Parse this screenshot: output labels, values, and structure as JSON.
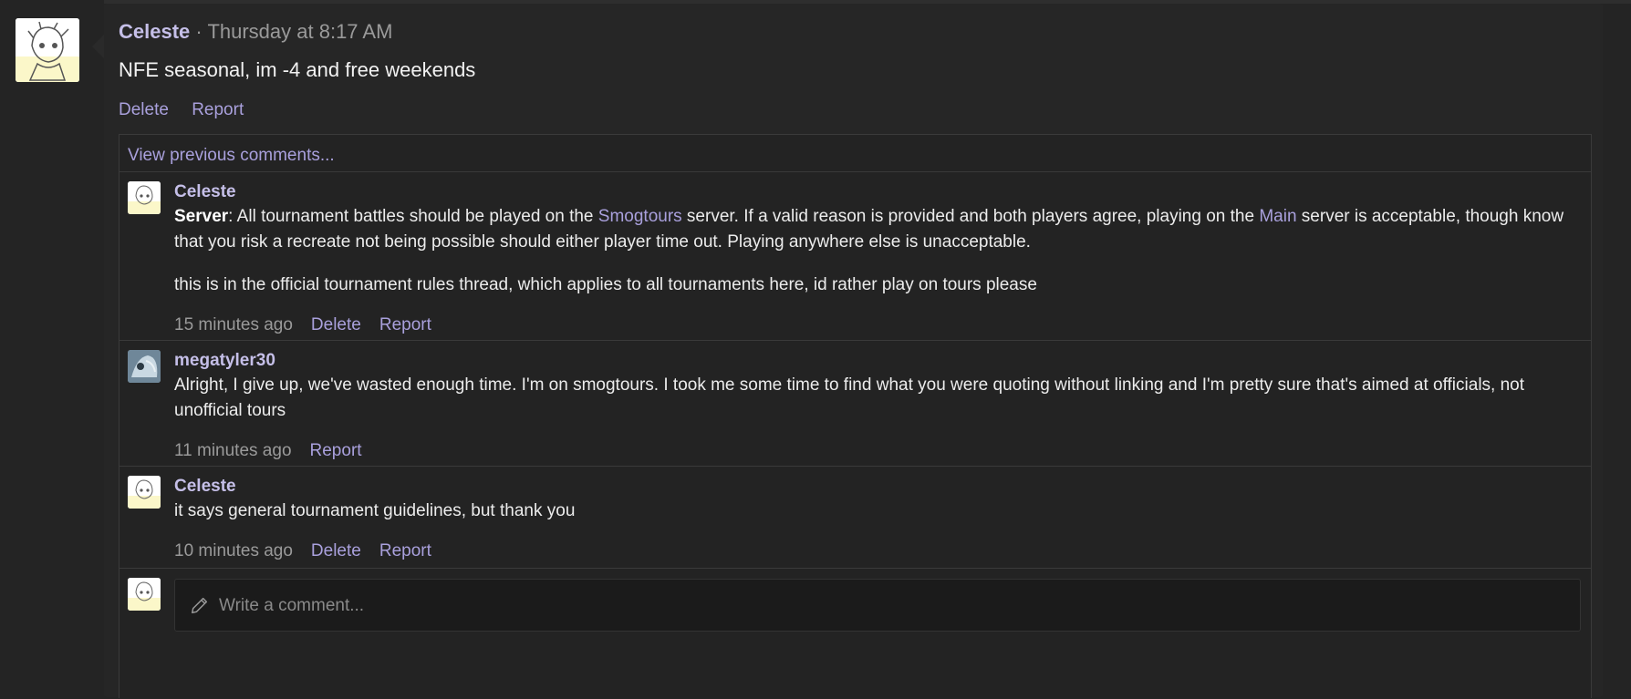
{
  "post": {
    "author": "Celeste",
    "separator": " · ",
    "timestamp": "Thursday at 8:17 AM",
    "text": "NFE seasonal, im -4 and free weekends",
    "actions": {
      "delete": "Delete",
      "report": "Report"
    }
  },
  "comments_section": {
    "view_previous": "View previous comments...",
    "comments": [
      {
        "author": "Celeste",
        "label": "Server",
        "t1": ": All tournament battles should be played on the ",
        "link1": "Smogtours",
        "t2": " server. If a valid reason is provided and both players agree, playing on the ",
        "link2": "Main",
        "t3": " server is acceptable, though know that you risk a recreate not being possible should either player time out. Playing anywhere else is unacceptable.",
        "para2": "this is in the official tournament rules thread, which applies to all tournaments here, id rather play on tours please",
        "time": "15 minutes ago",
        "delete": "Delete",
        "report": "Report"
      },
      {
        "author": "megatyler30",
        "text": "Alright, I give up, we've wasted enough time. I'm on smogtours. I took me some time to find what you were quoting without linking and I'm pretty sure that's aimed at officials, not unofficial tours",
        "time": "11 minutes ago",
        "report": "Report"
      },
      {
        "author": "Celeste",
        "text": "it says general tournament guidelines, but thank you",
        "time": "10 minutes ago",
        "delete": "Delete",
        "report": "Report"
      }
    ],
    "composer": {
      "placeholder": "Write a comment..."
    }
  }
}
